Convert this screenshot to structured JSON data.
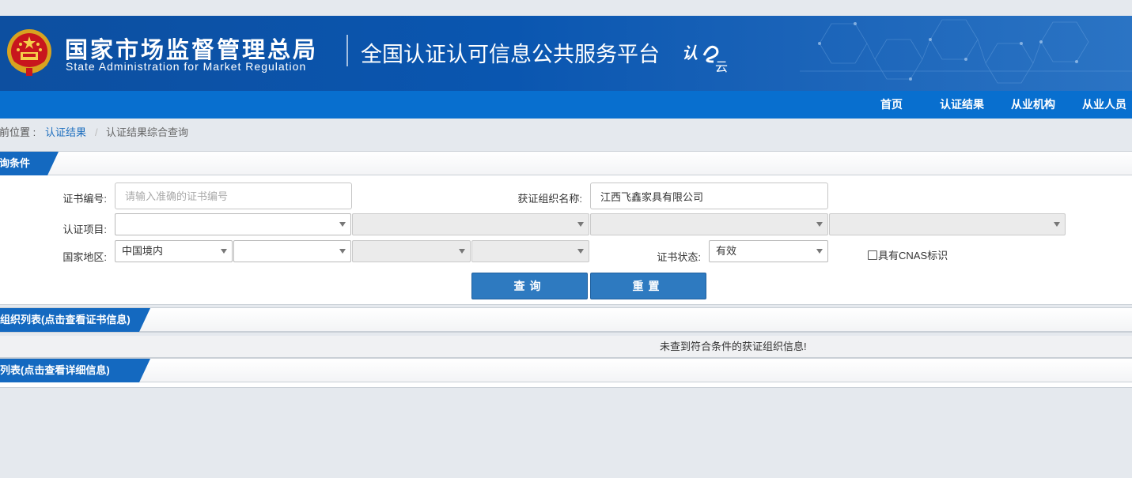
{
  "header": {
    "org_name_cn": "国家市场监督管理总局",
    "org_name_en": "State Administration  for  Market Regulation",
    "platform_title": "全国认证认可信息公共服务平台",
    "logo_text": "认e云"
  },
  "nav": {
    "items": [
      {
        "label": "首页"
      },
      {
        "label": "认证结果"
      },
      {
        "label": "从业机构"
      },
      {
        "label": "从业人员"
      }
    ]
  },
  "breadcrumb": {
    "prefix": "当前位置 :",
    "link": "认证结果",
    "separator": "/",
    "current": "认证结果综合查询"
  },
  "query_panel": {
    "tab_label": "查询条件",
    "cert_no_label": "证书编号:",
    "cert_no_placeholder": "请输入准确的证书编号",
    "cert_no_value": "",
    "org_name_label": "获证组织名称:",
    "org_name_value": "江西飞鑫家具有限公司",
    "project_label": "认证项目:",
    "region_label": "国家地区:",
    "region_value": "中国境内",
    "status_label": "证书状态:",
    "status_value": "有效",
    "cnas_label": "具有CNAS标识",
    "search_button": "查询",
    "reset_button": "重置"
  },
  "org_list": {
    "tab_label": "获证组织列表(点击查看证书信息)",
    "empty_message": "未查到符合条件的获证组织信息!"
  },
  "cert_list": {
    "tab_label": "证书列表(点击查看详细信息)"
  },
  "colors": {
    "banner": "#0d4fa0",
    "nav": "#086fcf",
    "tab": "#1469c0",
    "button": "#2e7ac0",
    "link": "#1e6fbf"
  }
}
